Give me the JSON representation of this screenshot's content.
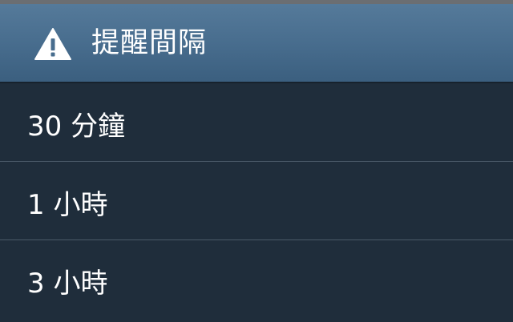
{
  "dialog": {
    "title": "提醒間隔",
    "title_icon": "warning-triangle-icon"
  },
  "options": [
    {
      "label": "30 分鐘"
    },
    {
      "label": "1 小時"
    },
    {
      "label": "3 小時"
    }
  ],
  "colors": {
    "header": "#486d8e",
    "background": "#1f2d3b",
    "divider": "#4a5a69",
    "text": "#ffffff"
  }
}
